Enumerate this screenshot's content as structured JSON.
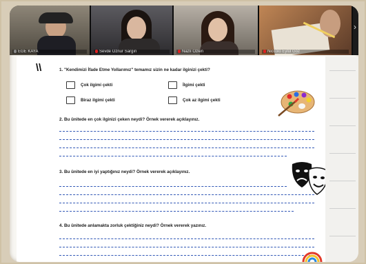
{
  "participants": [
    {
      "name": "EGE KAYA",
      "mic_muted": false
    },
    {
      "name": "Sevde Öznur Sargın",
      "mic_muted": true
    },
    {
      "name": "Nazlı Özlen",
      "mic_muted": true
    },
    {
      "name": "Niccolò Eylül Göz",
      "mic_muted": true
    }
  ],
  "worksheet": {
    "q1": "1. \"Kendimizi İfade Etme Yollarımız\" temamız sizin ne kadar ilginizi çekti?",
    "options": [
      "Çok ilgimi çekti",
      "İlgimi çekti",
      "Biraz ilgimi çekti",
      "Çok az ilgimi çekti"
    ],
    "q2": "2. Bu ünitede en çok ilginizi çeken neydi? Örnek vererek açıklayınız.",
    "q3": "3. Bu ünitede en iyi yaptığınız neydi? Örnek vererek açıklayınız.",
    "q4": "4. Bu ünitede anlamakta zorluk çektiğiniz neydi? Örnek vererek yazınız."
  },
  "decorations": [
    "palette-icon",
    "theatre-masks-icon"
  ]
}
